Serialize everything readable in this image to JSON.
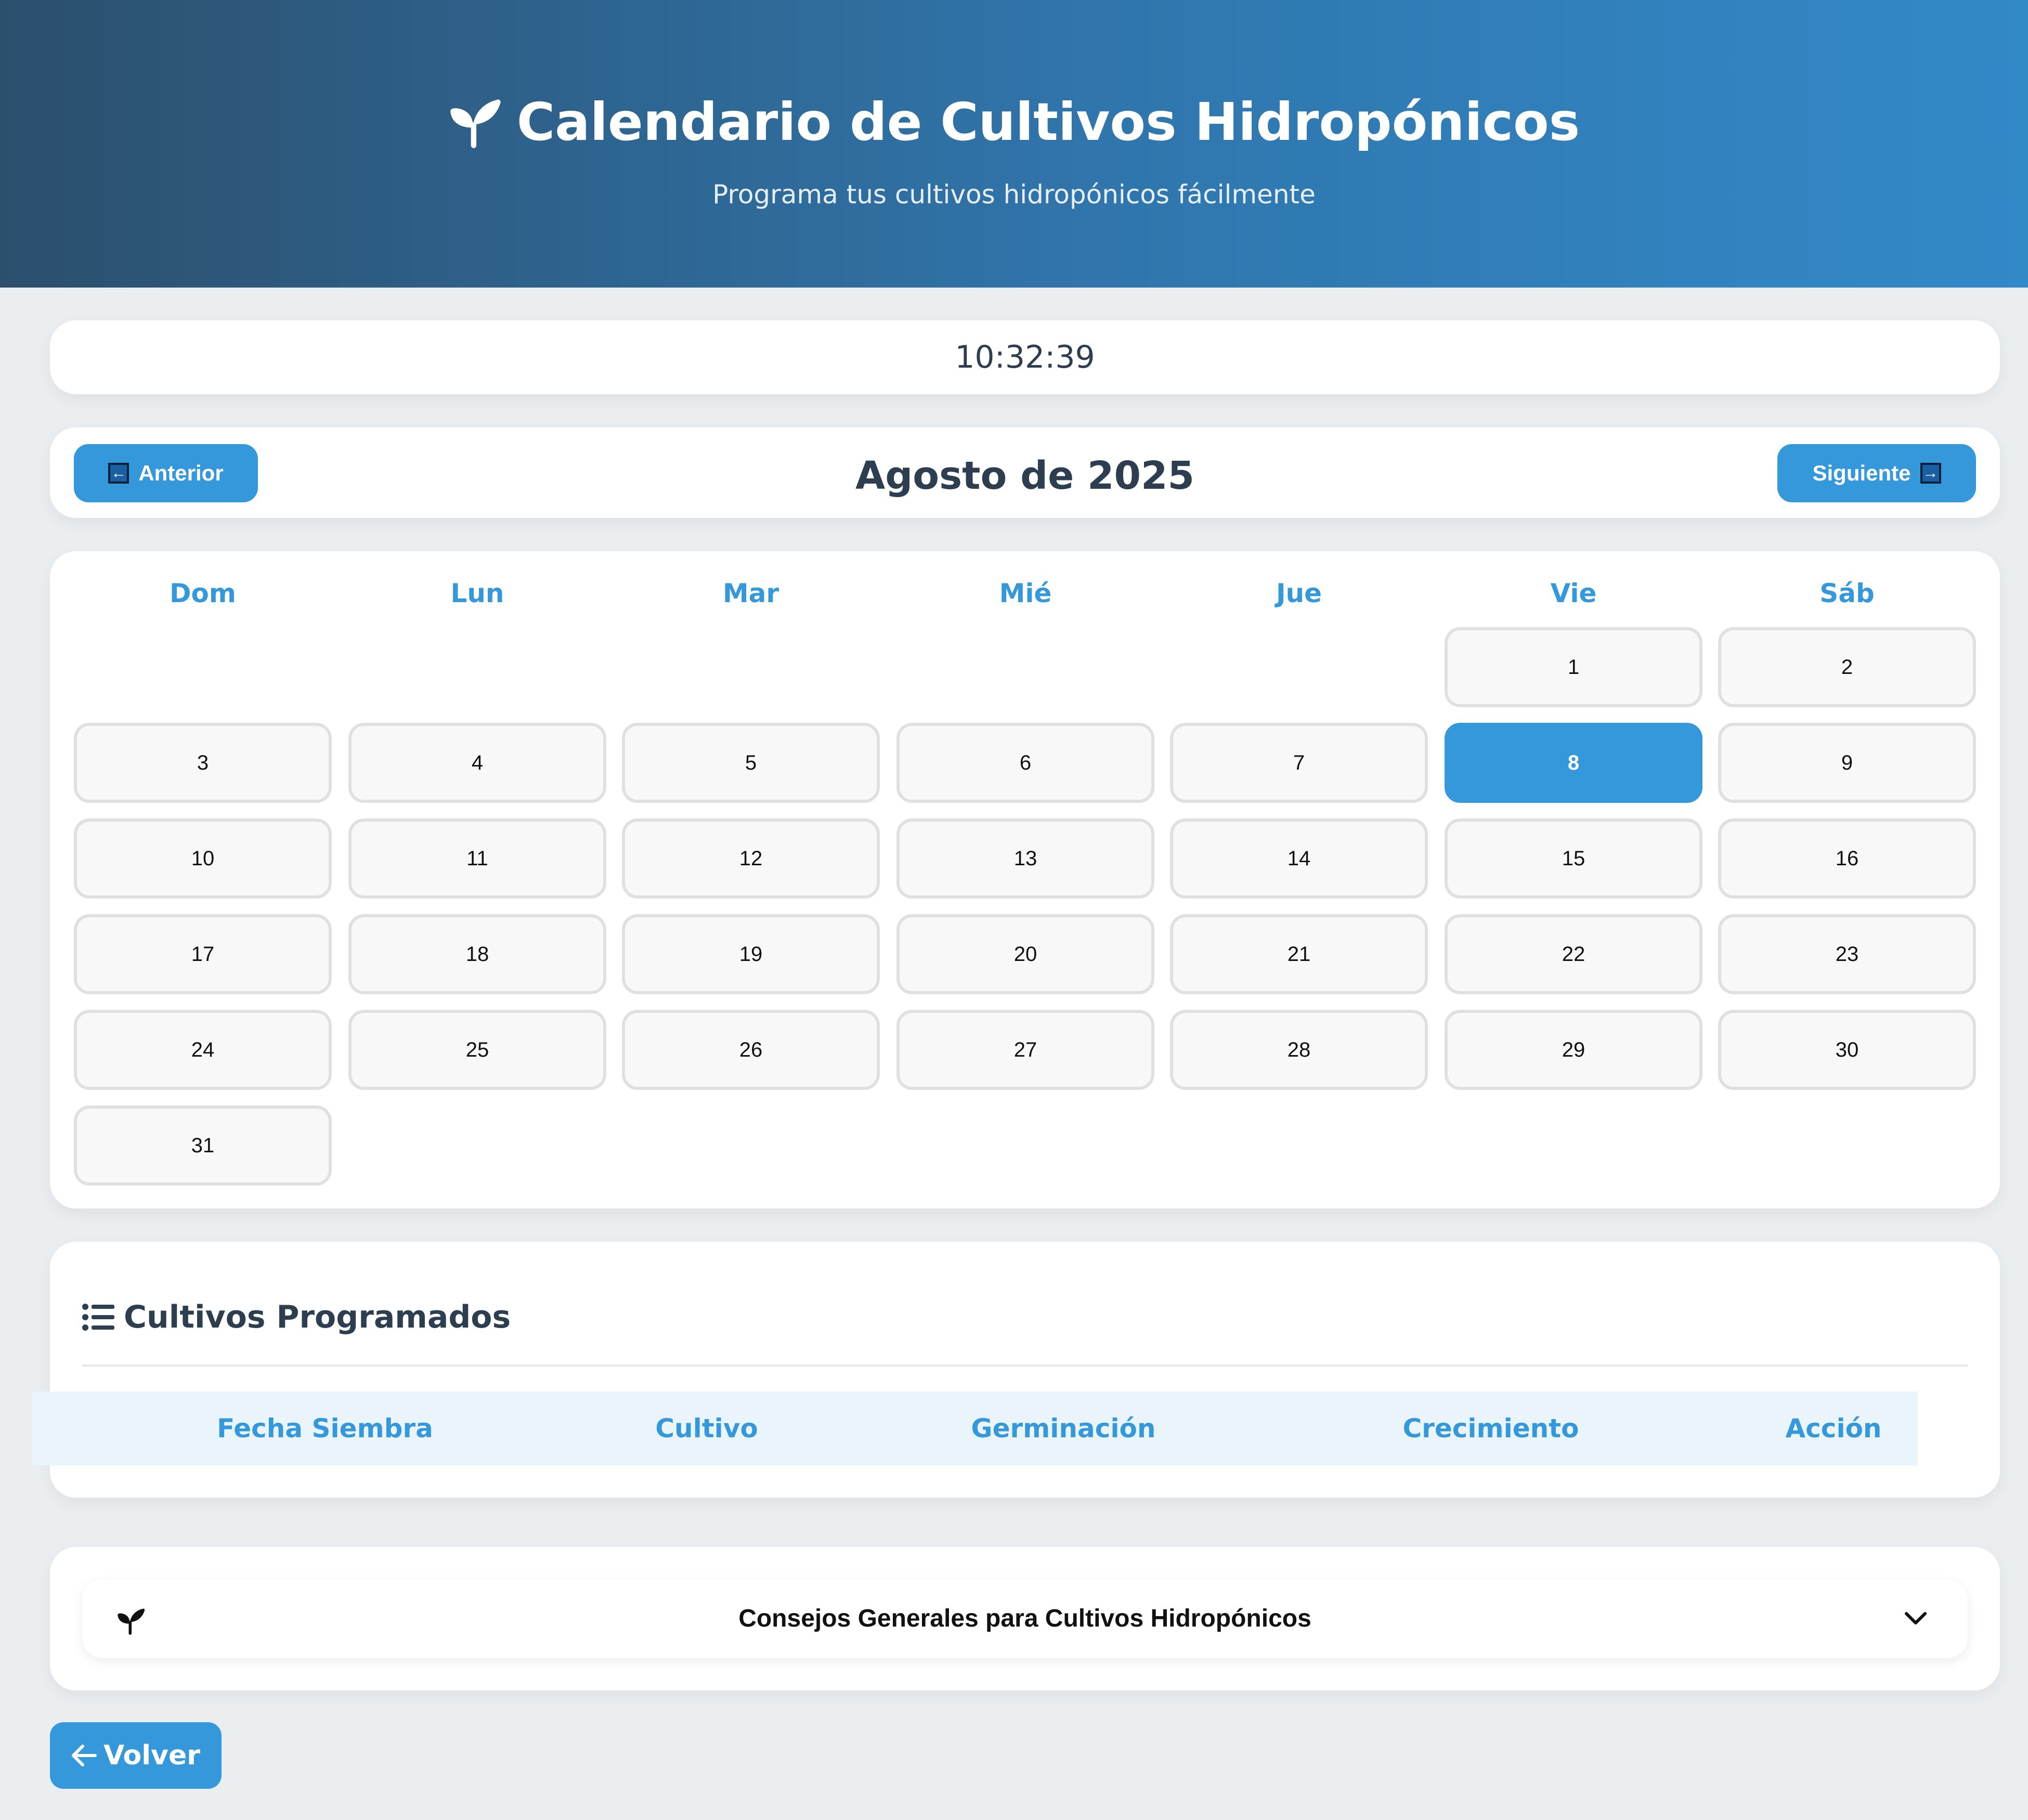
{
  "header": {
    "title": "Calendario de Cultivos Hidropónicos",
    "subtitle": "Programa tus cultivos hidropónicos fácilmente",
    "icon": "seedling-icon"
  },
  "clock": {
    "time": "10:32:39"
  },
  "nav": {
    "prev_label": "Anterior",
    "next_label": "Siguiente",
    "month_label": "Agosto de 2025"
  },
  "calendar": {
    "weekdays": [
      "Dom",
      "Lun",
      "Mar",
      "Mié",
      "Jue",
      "Vie",
      "Sáb"
    ],
    "first_weekday_index": 5,
    "days_in_month": 31,
    "selected_day": 8
  },
  "scheduled": {
    "title": "Cultivos Programados",
    "icon": "list-icon",
    "columns": [
      "Fecha Siembra",
      "Cultivo",
      "Germinación",
      "Crecimiento",
      "Acción"
    ],
    "rows": []
  },
  "tips": {
    "title": "Consejos Generales para Cultivos Hidropónicos",
    "icon": "seedling-icon",
    "expanded": false
  },
  "back": {
    "label": "Volver"
  },
  "colors": {
    "accent": "#3498db",
    "header_start": "#2c4f6d",
    "header_end": "#3289c8",
    "text": "#2c3e50",
    "background": "#ebeef1"
  }
}
